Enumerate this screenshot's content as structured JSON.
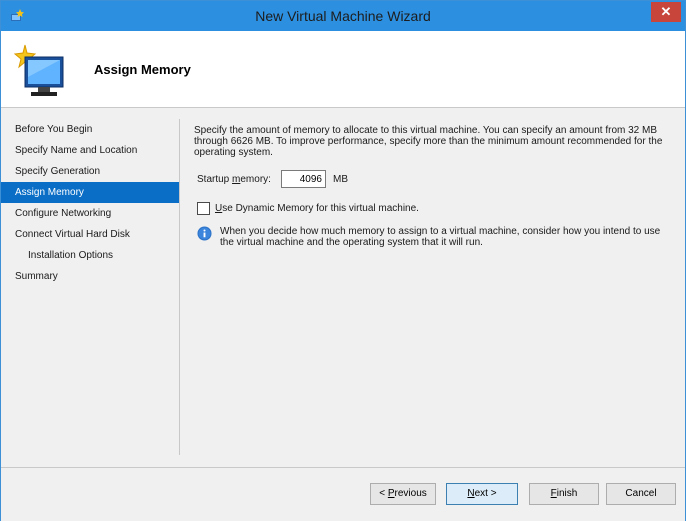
{
  "window": {
    "title": "New Virtual Machine Wizard"
  },
  "header": {
    "page_title": "Assign Memory"
  },
  "sidebar": {
    "items": [
      {
        "label": "Before You Begin"
      },
      {
        "label": "Specify Name and Location"
      },
      {
        "label": "Specify Generation"
      },
      {
        "label": "Assign Memory",
        "active": true
      },
      {
        "label": "Configure Networking"
      },
      {
        "label": "Connect Virtual Hard Disk"
      },
      {
        "label": "Installation Options",
        "sub": true
      },
      {
        "label": "Summary"
      }
    ]
  },
  "content": {
    "description": "Specify the amount of memory to allocate to this virtual machine. You can specify an amount from 32 MB through 6626 MB. To improve performance, specify more than the minimum amount recommended for the operating system.",
    "startup_memory": {
      "label_pre": "Startup ",
      "label_mn": "m",
      "label_post": "emory:",
      "value": "4096",
      "unit": "MB"
    },
    "dynamic_memory": {
      "mn": "U",
      "label_rest": "se Dynamic Memory for this virtual machine.",
      "checked": false
    },
    "info_text": "When you decide how much memory to assign to a virtual machine, consider how you intend to use the virtual machine and the operating system that it will run."
  },
  "buttons": {
    "previous": {
      "pre": "< ",
      "mn": "P",
      "rest": "revious"
    },
    "next": {
      "mn": "N",
      "rest": "ext >"
    },
    "finish": {
      "mn": "F",
      "rest": "inish"
    },
    "cancel": {
      "label": "Cancel"
    }
  },
  "colors": {
    "titlebar": "#2c8fe0",
    "selection": "#0a6ec7",
    "close": "#c7453a"
  },
  "icons": [
    "vm-wizard-icon",
    "close-icon",
    "new-vm-icon",
    "info-icon"
  ]
}
